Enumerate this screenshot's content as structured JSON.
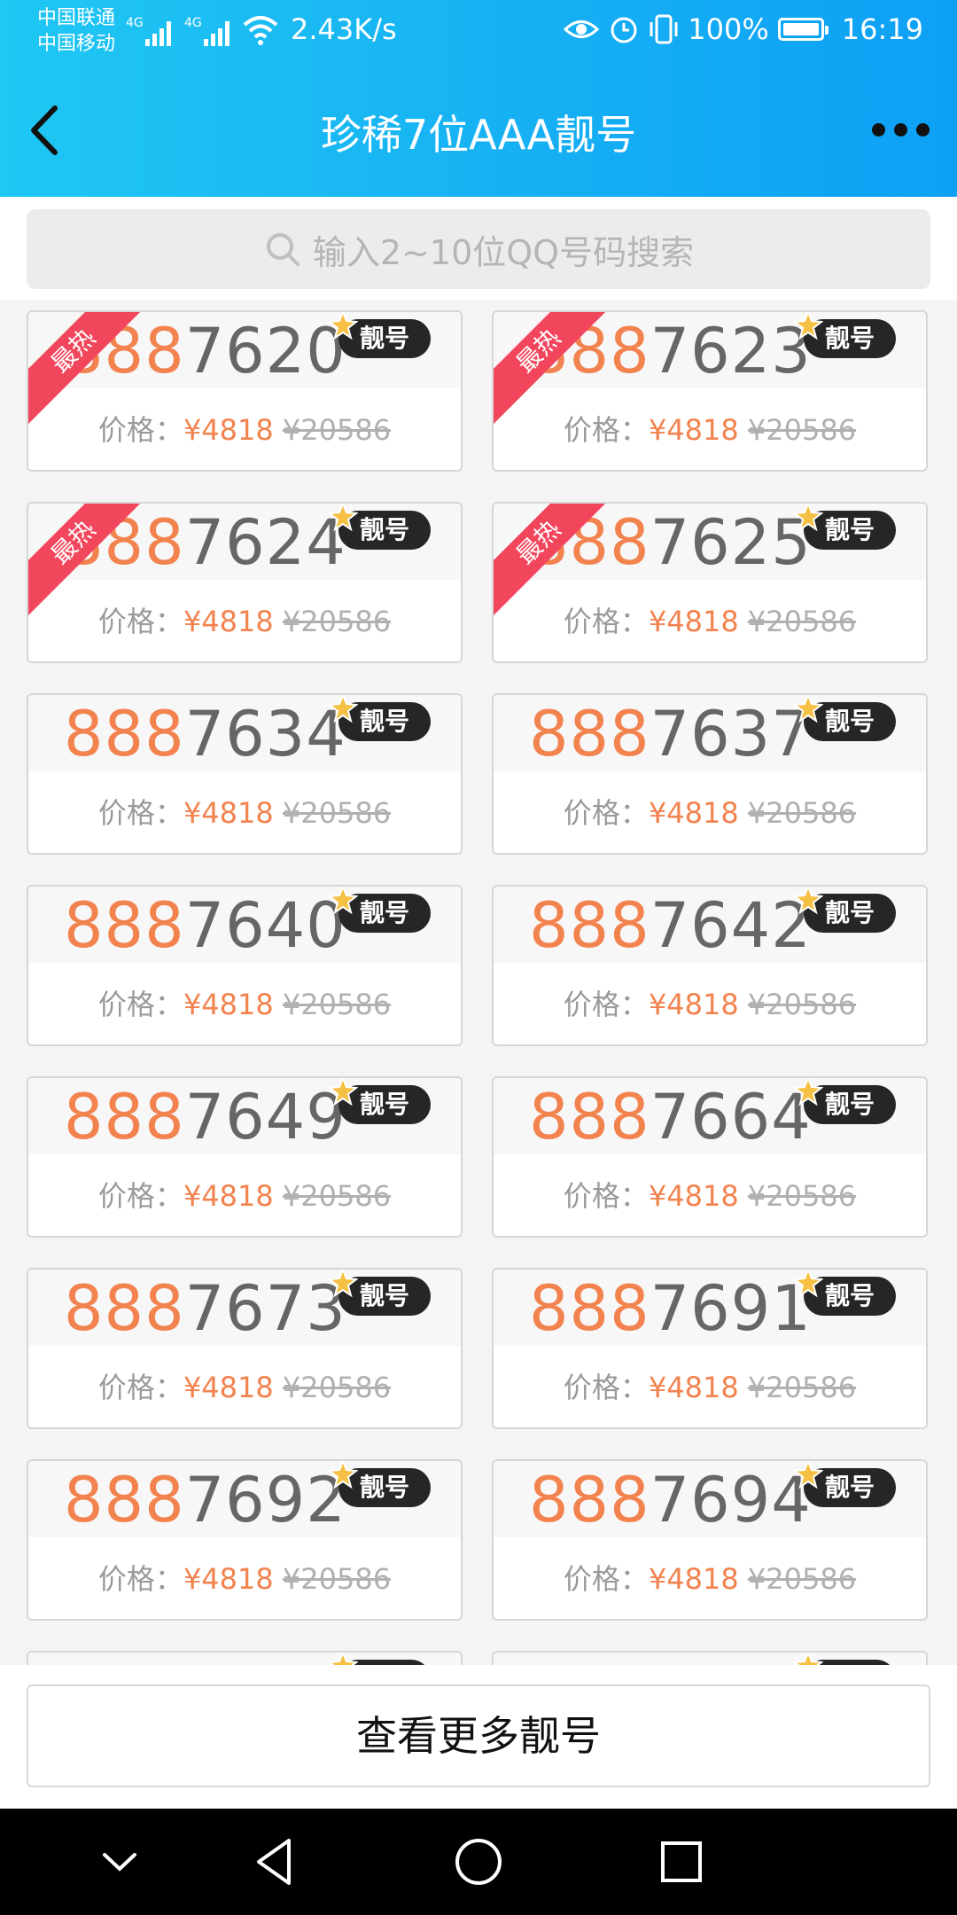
{
  "status_bar": {
    "carrier1": "中国联通",
    "carrier2": "中国移动",
    "net1": "4G",
    "net2": "4G",
    "speed": "2.43K/s",
    "battery": "100%",
    "time": "16:19"
  },
  "header": {
    "title": "珍稀7位AAA靓号"
  },
  "search": {
    "placeholder": "输入2~10位QQ号码搜索"
  },
  "accent_color": "#f2834f",
  "hot_color": "#f2465c",
  "header_color": "#16b0f3",
  "badge_label": "靓号",
  "hot_label": "最热",
  "price_prefix": "价格：",
  "numbers": [
    {
      "prefix": "888",
      "suffix": "7620",
      "price": "¥4818",
      "old_price": "¥20586",
      "hot": true
    },
    {
      "prefix": "888",
      "suffix": "7623",
      "price": "¥4818",
      "old_price": "¥20586",
      "hot": true
    },
    {
      "prefix": "888",
      "suffix": "7624",
      "price": "¥4818",
      "old_price": "¥20586",
      "hot": true
    },
    {
      "prefix": "888",
      "suffix": "7625",
      "price": "¥4818",
      "old_price": "¥20586",
      "hot": true
    },
    {
      "prefix": "888",
      "suffix": "7634",
      "price": "¥4818",
      "old_price": "¥20586",
      "hot": false
    },
    {
      "prefix": "888",
      "suffix": "7637",
      "price": "¥4818",
      "old_price": "¥20586",
      "hot": false
    },
    {
      "prefix": "888",
      "suffix": "7640",
      "price": "¥4818",
      "old_price": "¥20586",
      "hot": false
    },
    {
      "prefix": "888",
      "suffix": "7642",
      "price": "¥4818",
      "old_price": "¥20586",
      "hot": false
    },
    {
      "prefix": "888",
      "suffix": "7649",
      "price": "¥4818",
      "old_price": "¥20586",
      "hot": false
    },
    {
      "prefix": "888",
      "suffix": "7664",
      "price": "¥4818",
      "old_price": "¥20586",
      "hot": false
    },
    {
      "prefix": "888",
      "suffix": "7673",
      "price": "¥4818",
      "old_price": "¥20586",
      "hot": false
    },
    {
      "prefix": "888",
      "suffix": "7691",
      "price": "¥4818",
      "old_price": "¥20586",
      "hot": false
    },
    {
      "prefix": "888",
      "suffix": "7692",
      "price": "¥4818",
      "old_price": "¥20586",
      "hot": false
    },
    {
      "prefix": "888",
      "suffix": "7694",
      "price": "¥4818",
      "old_price": "¥20586",
      "hot": false
    }
  ],
  "more_button": "查看更多靓号",
  "nav_icons": [
    "chevron-down-icon",
    "back-triangle-icon",
    "home-circle-icon",
    "recents-square-icon"
  ]
}
